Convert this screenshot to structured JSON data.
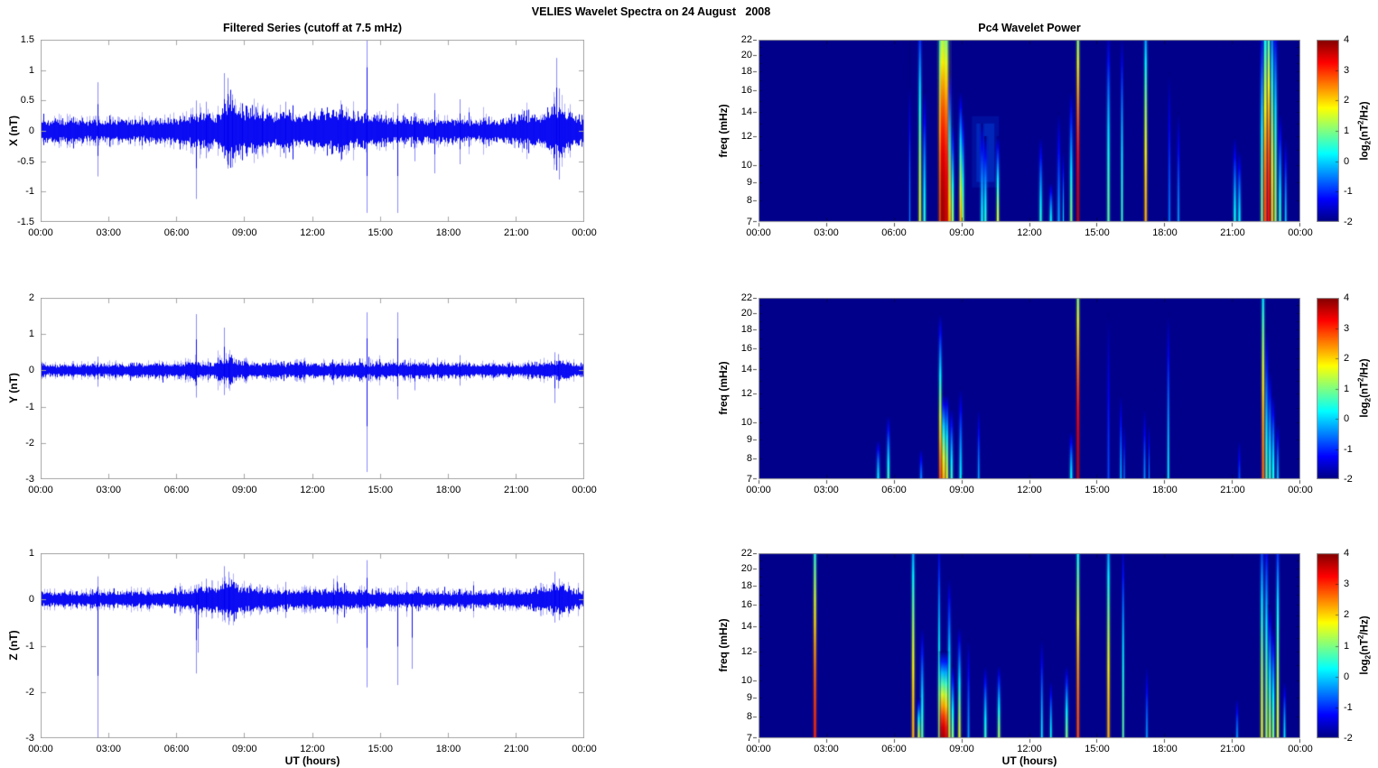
{
  "figure_title": "VELIES Wavelet Spectra on 24 August   2008",
  "left_column": {
    "title": "Filtered Series (cutoff at 7.5 mHz)",
    "xlabel": "UT (hours)",
    "x_tick_labels": [
      "00:00",
      "03:00",
      "06:00",
      "09:00",
      "12:00",
      "15:00",
      "18:00",
      "21:00",
      "00:00"
    ]
  },
  "right_column": {
    "title": "Pc4 Wavelet Power",
    "xlabel": "UT (hours)",
    "ylabel": "freq (mHz)",
    "x_tick_labels": [
      "00:00",
      "03:00",
      "06:00",
      "09:00",
      "12:00",
      "15:00",
      "18:00",
      "21:00",
      "00:00"
    ],
    "colorbar": {
      "ticks": [
        4,
        3,
        2,
        1,
        0,
        -1,
        -2
      ],
      "clim": [
        -2,
        4
      ],
      "label_pre": "log",
      "label_sub": "2",
      "label_mid": "(nT",
      "label_sup": "2",
      "label_post": "/Hz)"
    }
  },
  "chart_data": [
    {
      "type": "line",
      "component": "X",
      "title": "Filtered Series (cutoff at 7.5 mHz)",
      "ylabel": "X (nT)",
      "ylim": [
        -1.5,
        1.5
      ],
      "yticks": [
        -1.5,
        -1,
        -0.5,
        0,
        0.5,
        1,
        1.5
      ],
      "ytick_labels": [
        "-1.5",
        "-1",
        "-0.5",
        "0",
        "0.5",
        "1",
        "1.5"
      ],
      "xlim_hours": [
        0,
        24
      ],
      "xticks_hours": [
        0,
        3,
        6,
        9,
        12,
        15,
        18,
        21,
        24
      ],
      "line_color": "#0000f2",
      "noise_envelope": [
        [
          0,
          0.13
        ],
        [
          5.5,
          0.13
        ],
        [
          6.5,
          0.17
        ],
        [
          7.2,
          0.22
        ],
        [
          7.8,
          0.2
        ],
        [
          8.1,
          0.32
        ],
        [
          8.35,
          0.42
        ],
        [
          8.6,
          0.3
        ],
        [
          9.3,
          0.26
        ],
        [
          10,
          0.2
        ],
        [
          10.9,
          0.22
        ],
        [
          11.5,
          0.17
        ],
        [
          12.3,
          0.22
        ],
        [
          13.2,
          0.24
        ],
        [
          13.8,
          0.18
        ],
        [
          14.5,
          0.18
        ],
        [
          15.2,
          0.16
        ],
        [
          16,
          0.15
        ],
        [
          17,
          0.15
        ],
        [
          18,
          0.14
        ],
        [
          19,
          0.13
        ],
        [
          20.5,
          0.13
        ],
        [
          21.3,
          0.17
        ],
        [
          22,
          0.15
        ],
        [
          22.5,
          0.28
        ],
        [
          22.9,
          0.32
        ],
        [
          23.3,
          0.22
        ],
        [
          24,
          0.16
        ]
      ],
      "spikes": [
        [
          2.52,
          0.8,
          -0.75
        ],
        [
          6.85,
          0.5,
          -1.12
        ],
        [
          7.3,
          0.48,
          -0.45
        ],
        [
          8.1,
          0.95,
          -0.45
        ],
        [
          8.25,
          0.87,
          -0.62
        ],
        [
          8.45,
          0.6,
          -0.6
        ],
        [
          8.9,
          0.45,
          -0.42
        ],
        [
          9.75,
          0.38,
          -0.38
        ],
        [
          10.8,
          0.48,
          -0.45
        ],
        [
          14.4,
          1.9,
          -1.35
        ],
        [
          15.75,
          0.45,
          -1.35
        ],
        [
          16.5,
          0.3,
          -0.5
        ],
        [
          17.4,
          0.62,
          -0.7
        ],
        [
          18.5,
          0.52,
          -0.55
        ],
        [
          22.75,
          1.2,
          -0.55
        ],
        [
          22.9,
          0.7,
          -0.8
        ]
      ]
    },
    {
      "type": "line",
      "component": "Y",
      "ylabel": "Y (nT)",
      "ylim": [
        -3,
        2
      ],
      "yticks": [
        -3,
        -2,
        -1,
        0,
        1,
        2
      ],
      "ytick_labels": [
        "-3",
        "-2",
        "-1",
        "0",
        "1",
        "2"
      ],
      "xlim_hours": [
        0,
        24
      ],
      "xticks_hours": [
        0,
        3,
        6,
        9,
        12,
        15,
        18,
        21,
        24
      ],
      "line_color": "#0000f2",
      "noise_envelope": [
        [
          0,
          0.12
        ],
        [
          2,
          0.12
        ],
        [
          5.5,
          0.14
        ],
        [
          6.5,
          0.16
        ],
        [
          7.5,
          0.15
        ],
        [
          8.1,
          0.22
        ],
        [
          8.4,
          0.28
        ],
        [
          8.7,
          0.18
        ],
        [
          9.5,
          0.15
        ],
        [
          11,
          0.14
        ],
        [
          12.5,
          0.15
        ],
        [
          13.5,
          0.16
        ],
        [
          14.5,
          0.15
        ],
        [
          16,
          0.13
        ],
        [
          17.5,
          0.15
        ],
        [
          19,
          0.13
        ],
        [
          21,
          0.12
        ],
        [
          22.4,
          0.17
        ],
        [
          22.9,
          0.2
        ],
        [
          23.4,
          0.15
        ],
        [
          24,
          0.13
        ]
      ],
      "spikes": [
        [
          2.52,
          0.38,
          -0.45
        ],
        [
          6.85,
          1.55,
          -0.75
        ],
        [
          8.1,
          1.18,
          -0.68
        ],
        [
          8.3,
          0.45,
          -0.5
        ],
        [
          12.9,
          0.1,
          -0.4
        ],
        [
          14.4,
          1.6,
          -2.8
        ],
        [
          15.75,
          1.6,
          -0.8
        ],
        [
          16.5,
          0.3,
          -0.55
        ],
        [
          17.5,
          0.35,
          -0.3
        ],
        [
          18.5,
          0.42,
          -0.42
        ],
        [
          22.7,
          0.5,
          -0.9
        ],
        [
          22.85,
          0.45,
          -0.5
        ]
      ]
    },
    {
      "type": "line",
      "component": "Z",
      "ylabel": "Z (nT)",
      "xlabel": "UT (hours)",
      "ylim": [
        -3,
        1
      ],
      "yticks": [
        -3,
        -2,
        -1,
        0,
        1
      ],
      "ytick_labels": [
        "-3",
        "-2",
        "-1",
        "0",
        "1"
      ],
      "xlim_hours": [
        0,
        24
      ],
      "xticks_hours": [
        0,
        3,
        6,
        9,
        12,
        15,
        18,
        21,
        24
      ],
      "line_color": "#0000f2",
      "noise_envelope": [
        [
          0,
          0.11
        ],
        [
          2,
          0.11
        ],
        [
          5,
          0.12
        ],
        [
          6.5,
          0.15
        ],
        [
          7.2,
          0.18
        ],
        [
          7.9,
          0.2
        ],
        [
          8.2,
          0.3
        ],
        [
          8.5,
          0.32
        ],
        [
          8.8,
          0.22
        ],
        [
          9.5,
          0.18
        ],
        [
          10.5,
          0.15
        ],
        [
          11.5,
          0.13
        ],
        [
          12.5,
          0.16
        ],
        [
          13.3,
          0.17
        ],
        [
          14.2,
          0.14
        ],
        [
          15,
          0.13
        ],
        [
          16.5,
          0.12
        ],
        [
          18,
          0.12
        ],
        [
          20,
          0.12
        ],
        [
          21.5,
          0.13
        ],
        [
          22.4,
          0.2
        ],
        [
          22.9,
          0.24
        ],
        [
          23.4,
          0.16
        ],
        [
          24,
          0.13
        ]
      ],
      "spikes": [
        [
          2.52,
          0.5,
          -3.0
        ],
        [
          6.85,
          0.32,
          -1.6
        ],
        [
          6.95,
          0.2,
          -1.15
        ],
        [
          7.3,
          0.45,
          -0.38
        ],
        [
          8.1,
          0.72,
          -0.45
        ],
        [
          8.3,
          0.6,
          -0.55
        ],
        [
          10.8,
          0.38,
          -0.4
        ],
        [
          12.9,
          0.45,
          -0.25
        ],
        [
          14.4,
          0.85,
          -1.9
        ],
        [
          15.75,
          0.3,
          -1.85
        ],
        [
          16.4,
          0.2,
          -1.5
        ],
        [
          22.7,
          0.6,
          -0.5
        ],
        [
          22.9,
          0.45,
          -0.45
        ]
      ]
    },
    {
      "type": "heatmap",
      "component": "X",
      "title": "Pc4 Wavelet Power",
      "ylabel": "freq (mHz)",
      "flim": [
        7,
        22
      ],
      "fticks": [
        7,
        8,
        9,
        10,
        12,
        14,
        16,
        18,
        20,
        22
      ],
      "clim": [
        -2,
        4
      ],
      "xlim_hours": [
        0,
        24
      ],
      "xticks_hours": [
        0,
        3,
        6,
        9,
        12,
        15,
        18,
        21,
        24
      ],
      "haze": [
        [
          9.65,
          10.45,
          9,
          13,
          -0.7
        ]
      ],
      "events": [
        [
          6.7,
          22,
          -0.5,
          1
        ],
        [
          7.15,
          22,
          1.5,
          2
        ],
        [
          7.35,
          16,
          0.5,
          2
        ],
        [
          8.05,
          22,
          2.5,
          2
        ],
        [
          8.15,
          22,
          3.8,
          4
        ],
        [
          8.3,
          22,
          3.5,
          4
        ],
        [
          8.45,
          18,
          2.0,
          3
        ],
        [
          8.6,
          13,
          1.0,
          2
        ],
        [
          8.95,
          16,
          2.2,
          2
        ],
        [
          9.05,
          14,
          1.0,
          2
        ],
        [
          9.9,
          13,
          0.3,
          2
        ],
        [
          10.05,
          12,
          0.5,
          2
        ],
        [
          10.6,
          12,
          1.5,
          2
        ],
        [
          12.5,
          12,
          0.5,
          2
        ],
        [
          12.95,
          9,
          0.3,
          2
        ],
        [
          13.3,
          14,
          -0.3,
          2
        ],
        [
          13.5,
          11,
          0.0,
          1
        ],
        [
          13.85,
          16,
          1.0,
          2
        ],
        [
          14.15,
          22,
          3.6,
          2
        ],
        [
          15.5,
          22,
          0.8,
          2
        ],
        [
          16.1,
          22,
          0.6,
          1.5
        ],
        [
          17.15,
          22,
          2.2,
          2
        ],
        [
          18.2,
          18,
          -0.5,
          1.5
        ],
        [
          18.6,
          14,
          -0.3,
          1.5
        ],
        [
          21.1,
          12,
          0.4,
          2
        ],
        [
          21.3,
          11,
          0.3,
          2
        ],
        [
          22.3,
          22,
          1.0,
          2
        ],
        [
          22.45,
          22,
          2.8,
          2.5
        ],
        [
          22.6,
          22,
          3.2,
          2
        ],
        [
          22.75,
          22,
          2.0,
          2
        ],
        [
          22.9,
          22,
          1.2,
          2
        ],
        [
          23.1,
          14,
          0.6,
          2
        ],
        [
          23.35,
          12,
          0.0,
          1.5
        ]
      ]
    },
    {
      "type": "heatmap",
      "component": "Y",
      "ylabel": "freq (mHz)",
      "flim": [
        7,
        22
      ],
      "fticks": [
        7,
        8,
        9,
        10,
        12,
        14,
        16,
        18,
        20,
        22
      ],
      "clim": [
        -2,
        4
      ],
      "xlim_hours": [
        0,
        24
      ],
      "xticks_hours": [
        0,
        3,
        6,
        9,
        12,
        15,
        18,
        21,
        24
      ],
      "haze": [],
      "events": [
        [
          5.3,
          9,
          0.2,
          2
        ],
        [
          5.75,
          10.5,
          0.6,
          2
        ],
        [
          7.2,
          8.5,
          -0.5,
          2
        ],
        [
          8.05,
          20,
          2.8,
          2
        ],
        [
          8.2,
          12,
          2.2,
          3
        ],
        [
          8.35,
          12,
          1.5,
          2
        ],
        [
          8.55,
          11,
          0.6,
          2
        ],
        [
          8.95,
          12.5,
          0.2,
          2
        ],
        [
          9.75,
          11,
          -0.3,
          1.5
        ],
        [
          13.85,
          9.5,
          0.3,
          2
        ],
        [
          14.15,
          22,
          3.6,
          2
        ],
        [
          15.5,
          20,
          -0.8,
          1.5
        ],
        [
          16.05,
          12,
          -0.2,
          1.5
        ],
        [
          16.2,
          10,
          -0.5,
          1
        ],
        [
          17.1,
          11,
          -0.4,
          1.5
        ],
        [
          17.3,
          10,
          -0.5,
          1
        ],
        [
          18.15,
          20,
          0.2,
          1.5
        ],
        [
          21.3,
          9,
          -0.8,
          1.5
        ],
        [
          22.35,
          22,
          2.6,
          2
        ],
        [
          22.5,
          18,
          0.8,
          2
        ],
        [
          22.65,
          14,
          0.6,
          2
        ],
        [
          22.8,
          12,
          0.4,
          2
        ],
        [
          23.0,
          10,
          0.0,
          1.5
        ]
      ]
    },
    {
      "type": "heatmap",
      "component": "Z",
      "ylabel": "freq (mHz)",
      "xlabel": "UT (hours)",
      "flim": [
        7,
        22
      ],
      "fticks": [
        7,
        8,
        9,
        10,
        12,
        14,
        16,
        18,
        20,
        22
      ],
      "clim": [
        -2,
        4
      ],
      "xlim_hours": [
        0,
        24
      ],
      "xticks_hours": [
        0,
        3,
        6,
        9,
        12,
        15,
        18,
        21,
        24
      ],
      "haze": [],
      "events": [
        [
          2.5,
          22,
          3.0,
          2
        ],
        [
          6.85,
          22,
          2.2,
          2
        ],
        [
          7.1,
          9,
          1.5,
          2
        ],
        [
          7.25,
          14,
          0.8,
          2
        ],
        [
          8.0,
          22,
          1.0,
          1.5
        ],
        [
          8.15,
          12,
          3.8,
          4
        ],
        [
          8.3,
          12,
          3.4,
          3
        ],
        [
          8.45,
          19,
          1.5,
          2
        ],
        [
          8.6,
          11,
          1.0,
          2
        ],
        [
          8.9,
          14,
          1.6,
          2
        ],
        [
          9.3,
          13,
          -0.3,
          1.5
        ],
        [
          10.05,
          11,
          0.6,
          2
        ],
        [
          10.65,
          11,
          1.2,
          2
        ],
        [
          12.55,
          13,
          0.2,
          1.5
        ],
        [
          12.95,
          10,
          0.4,
          1.5
        ],
        [
          13.65,
          11,
          1.0,
          2
        ],
        [
          14.15,
          22,
          2.8,
          2
        ],
        [
          15.5,
          22,
          2.2,
          2
        ],
        [
          16.15,
          22,
          0.8,
          1.5
        ],
        [
          17.2,
          11,
          -0.3,
          1.5
        ],
        [
          21.2,
          9,
          -0.3,
          1.5
        ],
        [
          22.3,
          22,
          1.6,
          2
        ],
        [
          22.5,
          22,
          1.2,
          2
        ],
        [
          22.65,
          16,
          1.4,
          2
        ],
        [
          22.8,
          14,
          1.0,
          2
        ],
        [
          23.0,
          22,
          1.5,
          2
        ],
        [
          23.3,
          10,
          0.2,
          1.5
        ]
      ]
    }
  ]
}
